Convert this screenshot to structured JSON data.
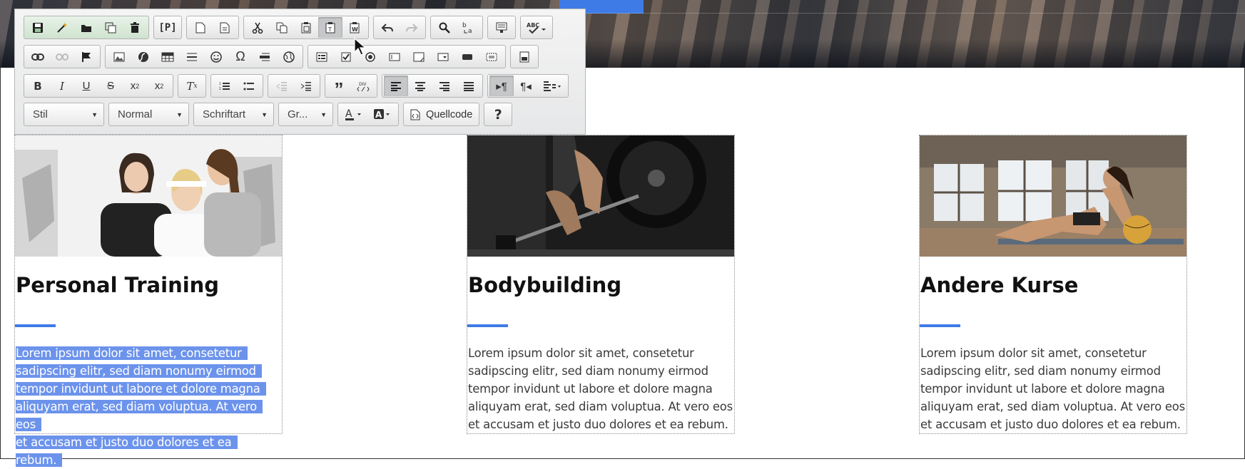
{
  "toolbar": {
    "row1": [
      {
        "name": "save-icon",
        "glyph": "💾"
      },
      {
        "name": "magic-wand-icon",
        "glyph": "✎"
      },
      {
        "name": "open-folder-icon",
        "glyph": "▬"
      },
      {
        "name": "copy-pages-icon",
        "glyph": "❐"
      },
      {
        "name": "trash-icon",
        "glyph": "🗑"
      },
      {
        "name": "paragraph-p-icon",
        "glyph": "[P]"
      },
      {
        "name": "new-page-icon",
        "glyph": "▯"
      },
      {
        "name": "preview-page-icon",
        "glyph": "▤"
      },
      {
        "name": "cut-icon",
        "glyph": "✂"
      },
      {
        "name": "copy-icon",
        "glyph": "⧉"
      },
      {
        "name": "paste-icon",
        "glyph": "📋"
      },
      {
        "name": "paste-text-icon",
        "glyph": "📋"
      },
      {
        "name": "paste-word-icon",
        "glyph": "📋"
      },
      {
        "name": "undo-icon",
        "glyph": "↶"
      },
      {
        "name": "redo-icon",
        "glyph": "↷"
      },
      {
        "name": "find-icon",
        "glyph": "🔍"
      },
      {
        "name": "replace-icon",
        "glyph": "ab"
      },
      {
        "name": "select-all-icon",
        "glyph": "▦"
      },
      {
        "name": "spellcheck-icon",
        "glyph": "ABC"
      }
    ],
    "style_combo": "Stil",
    "format_combo": "Normal",
    "font_combo": "Schriftart",
    "size_combo": "Gr...",
    "source_label": "Quellcode",
    "help_label": "?"
  },
  "cards": [
    {
      "title": "Personal Training",
      "text_lines": [
        "Lorem ipsum dolor sit amet, consetetur",
        "sadipscing elitr, sed diam nonumy eirmod",
        "tempor invidunt ut labore et dolore magna",
        "aliquyam erat, sed diam voluptua. At vero eos",
        "et accusam et justo duo dolores et ea rebum."
      ]
    },
    {
      "title": "Bodybuilding",
      "text": "Lorem ipsum dolor sit amet, consetetur sadipscing elitr, sed diam nonumy eirmod tempor invidunt ut labore et dolore magna aliquyam erat, sed diam voluptua. At vero eos et accusam et justo duo dolores et ea rebum."
    },
    {
      "title": "Andere Kurse",
      "text": "Lorem ipsum dolor sit amet, consetetur sadipscing elitr, sed diam nonumy eirmod tempor invidunt ut labore et dolore magna aliquyam erat, sed diam voluptua. At vero eos et accusam et justo duo dolores et ea rebum."
    }
  ],
  "colors": {
    "accent": "#3f7be6",
    "selection": "#6c93ec"
  }
}
